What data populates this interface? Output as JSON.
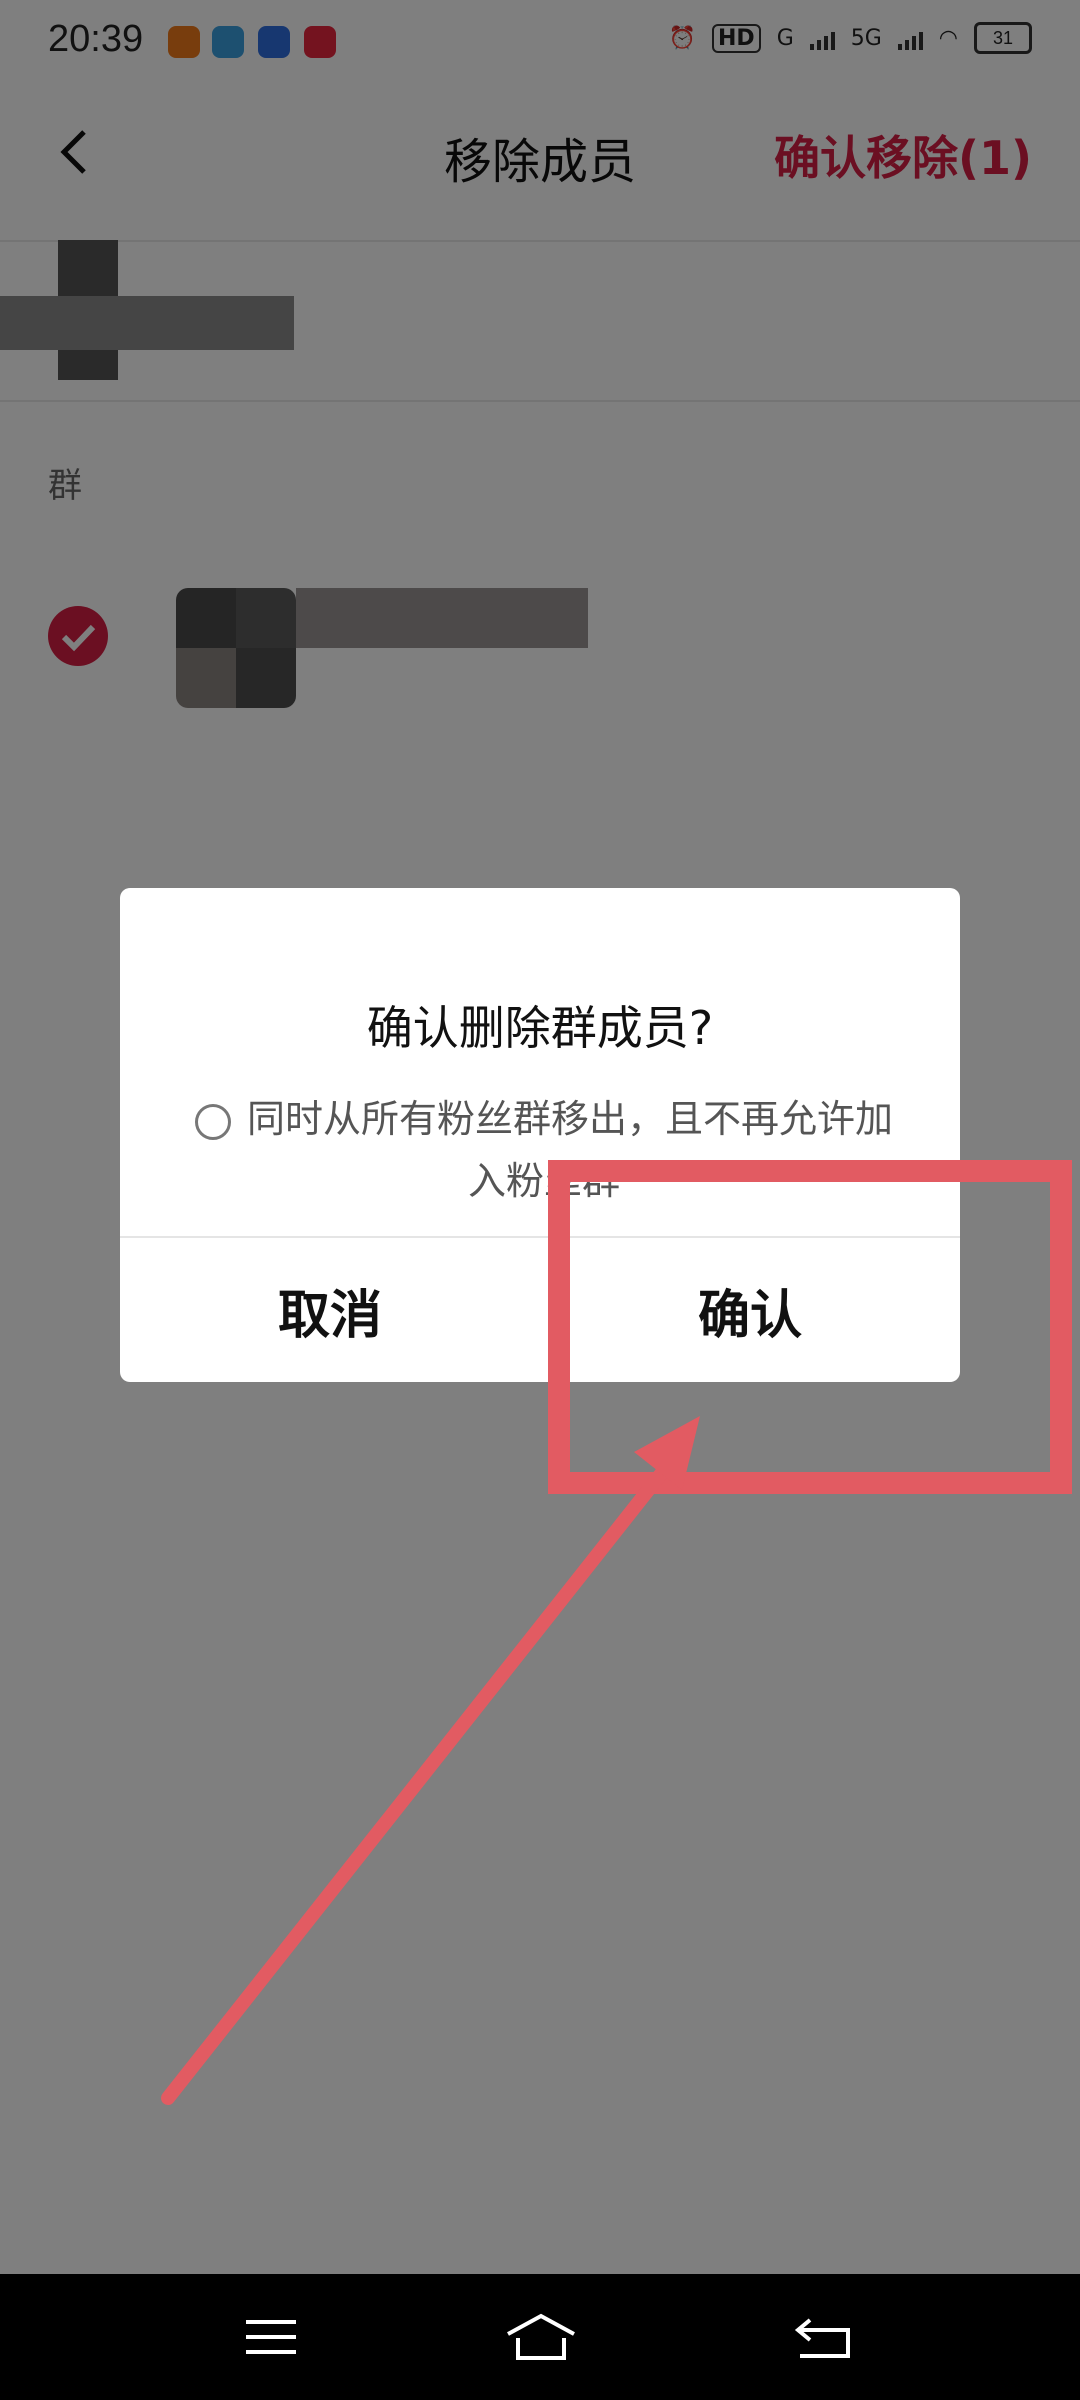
{
  "status_bar": {
    "time": "20:39",
    "network_label_1": "G",
    "network_label_2": "5G",
    "hd_label": "HD",
    "battery": "31"
  },
  "header": {
    "title": "移除成员",
    "confirm_label": "确认移除(1)"
  },
  "list": {
    "section_label": "群"
  },
  "dialog": {
    "title": "确认删除群成员?",
    "option_text": "同时从所有粉丝群移出，且不再允许加入粉丝群",
    "cancel_label": "取消",
    "confirm_label": "确认"
  },
  "colors": {
    "accent": "#d61f44",
    "annotation": "#e25b62"
  },
  "icons": {
    "back": "back-icon",
    "check": "check-icon",
    "menu": "menu-icon",
    "home": "home-icon",
    "return": "return-icon"
  }
}
